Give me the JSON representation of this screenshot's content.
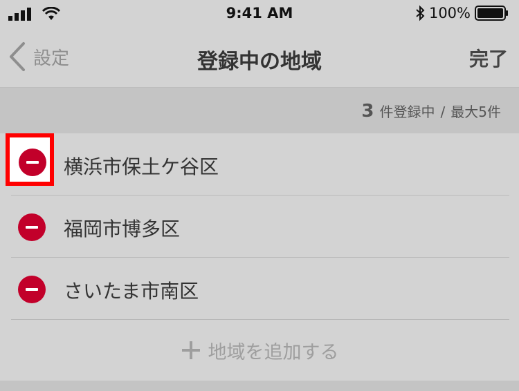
{
  "status_bar": {
    "time": "9:41 AM",
    "battery": "100%"
  },
  "nav": {
    "back_label": "設定",
    "title": "登録中の地域",
    "done_label": "完了"
  },
  "count": {
    "number": "3",
    "suffix": "件登録中",
    "divider": "/",
    "max": "最大5件"
  },
  "regions": [
    {
      "name": "横浜市保土ケ谷区"
    },
    {
      "name": "福岡市博多区"
    },
    {
      "name": "さいたま市南区"
    }
  ],
  "add": {
    "label": "地域を追加する"
  },
  "colors": {
    "accent_remove": "#c2002a",
    "highlight": "#ff0000"
  }
}
